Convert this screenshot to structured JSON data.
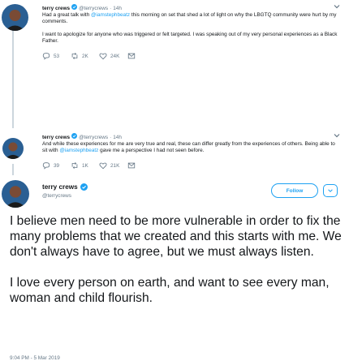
{
  "tweets": [
    {
      "name": "terry crews",
      "handle": "@terrycrews",
      "time": "14h",
      "text_pre": "Had a great talk with ",
      "mention": "@iamstephbeatz",
      "text_post": " this morning on set that shed a lot of light on why the LBGTQ community were hurt by my comments.",
      "text2": "I want to apologize for anyone who was triggered or felt targeted. I was speaking out of my very personal experiences as a Black Father.",
      "replies": "53",
      "retweets": "2K",
      "likes": "24K"
    },
    {
      "name": "terry crews",
      "handle": "@terrycrews",
      "time": "14h",
      "text_pre": "And while these experiences for me are very true and real, these can differ greatly from the experiences of others. Being able to sit with ",
      "mention": "@iamstephbeatz",
      "text_post": " gave me a perspective I had not seen before.",
      "replies": "39",
      "retweets": "1K",
      "likes": "21K"
    }
  ],
  "main": {
    "name": "terry crews",
    "handle": "@terrycrews",
    "follow_label": "Follow",
    "paragraph1": "I believe men need to be more vulnerable in order to fix the many problems that we created and this starts with me. We don't always have to agree, but we must always listen.",
    "paragraph2": "I love every person on earth, and want to see every man, woman and child flourish.",
    "timestamp": "9:04 PM - 5 Mar 2019"
  },
  "colors": {
    "accent": "#1da1f2",
    "secondary_text": "#657786",
    "thread_line": "#ccd6dd"
  },
  "icons": [
    "reply-icon",
    "retweet-icon",
    "like-icon",
    "message-icon",
    "verified-icon",
    "chevron-down-icon"
  ]
}
